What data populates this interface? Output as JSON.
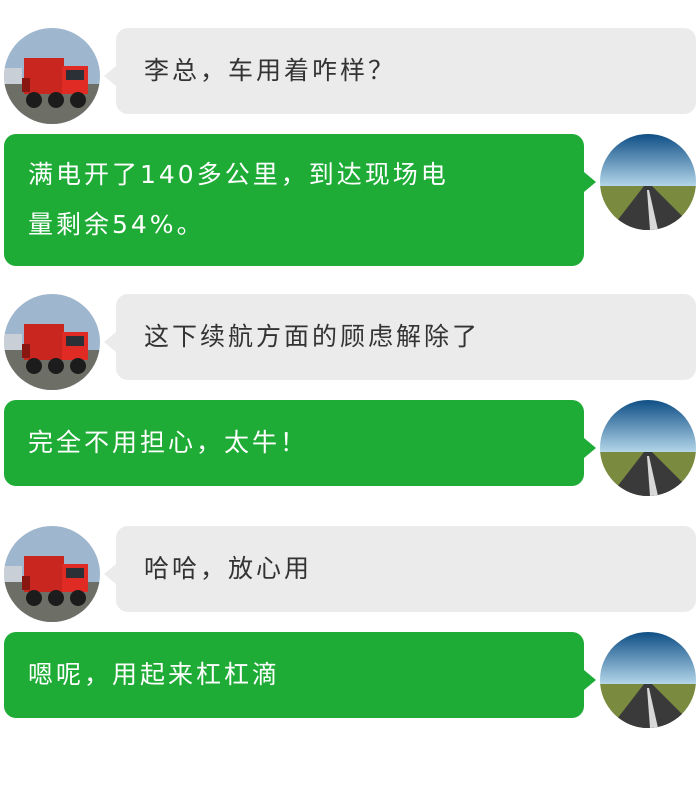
{
  "messages": [
    {
      "side": "left",
      "avatar": "truck-avatar",
      "text": "李总，车用着咋样？"
    },
    {
      "side": "right",
      "avatar": "road-avatar",
      "text_lines": [
        "满电开了140多公里，到达现场电",
        "量剩余54%。"
      ]
    },
    {
      "side": "left",
      "avatar": "truck-avatar",
      "text": "这下续航方面的顾虑解除了"
    },
    {
      "side": "right",
      "avatar": "road-avatar",
      "text": "完全不用担心，太牛！"
    },
    {
      "side": "left",
      "avatar": "truck-avatar",
      "text": "哈哈，放心用"
    },
    {
      "side": "right",
      "avatar": "road-avatar",
      "text": "嗯呢，用起来杠杠滴"
    }
  ],
  "colors": {
    "left_bubble": "#ebebeb",
    "right_bubble": "#1eac36",
    "left_text": "#333333",
    "right_text": "#ffffff"
  }
}
